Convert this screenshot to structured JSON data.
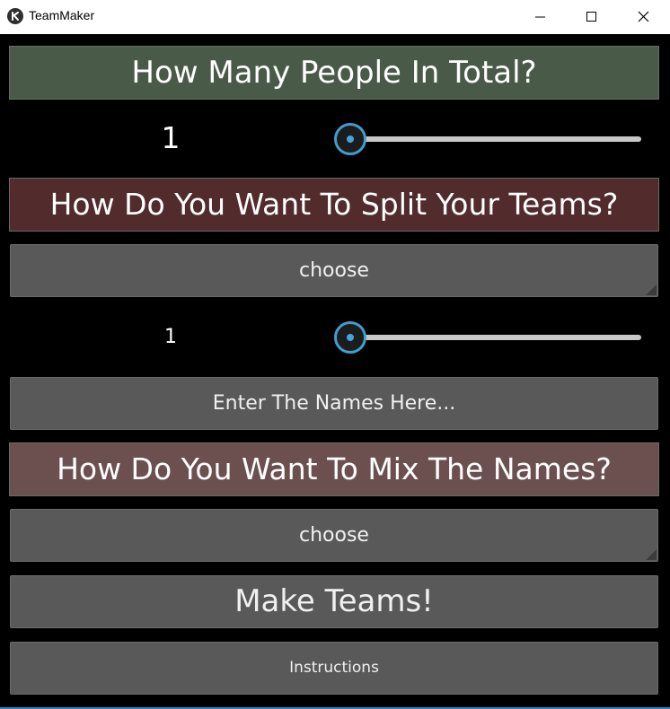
{
  "window": {
    "title": "TeamMaker",
    "icon": "kivy-logo-icon",
    "controls": [
      "minimize-icon",
      "maximize-icon",
      "close-icon"
    ]
  },
  "people_total": {
    "header": "How Many People In Total?",
    "value_label": "1",
    "slider_value": 1
  },
  "split": {
    "header": "How Do You Want To Split Your Teams?",
    "dropdown_label": "choose",
    "value_label": "1",
    "slider_value": 1
  },
  "names_button": "Enter The Names Here...",
  "mix": {
    "header": "How Do You Want To Mix The Names?",
    "dropdown_label": "choose"
  },
  "make_teams_button": "Make Teams!",
  "instructions_button": "Instructions",
  "colors": {
    "header_total": "#4a5a48",
    "header_split": "#522b2d",
    "header_mix": "#6c5050",
    "button": "#595959",
    "slider_accent": "#3f9ecf"
  }
}
